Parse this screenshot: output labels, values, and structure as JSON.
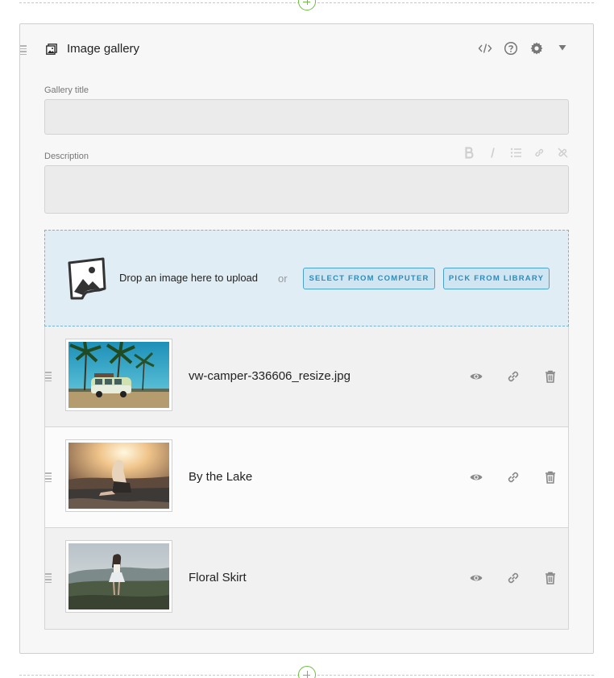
{
  "block": {
    "title": "Image gallery",
    "icons": [
      "gallery-icon",
      "code-icon",
      "help-icon",
      "gear-icon",
      "collapse-icon"
    ]
  },
  "fields": {
    "gallery_title_label": "Gallery title",
    "gallery_title_value": "",
    "description_label": "Description",
    "description_value": "",
    "editor_icons": [
      "bold-icon",
      "italic-icon",
      "list-icon",
      "link-icon",
      "unlink-icon"
    ]
  },
  "dropzone": {
    "text": "Drop an image here to upload",
    "or": "or",
    "select_label": "SELECT FROM COMPUTER",
    "library_label": "PICK FROM LIBRARY"
  },
  "images": [
    {
      "name": "vw-camper-336606_resize.jpg",
      "thumb": "vw-camper-photo"
    },
    {
      "name": "By the Lake",
      "thumb": "lake-photo"
    },
    {
      "name": "Floral Skirt",
      "thumb": "skirt-photo"
    }
  ],
  "row_icons": [
    "eye-icon",
    "link-icon",
    "trash-icon"
  ],
  "colors": {
    "accent": "#4aa3cc",
    "add_green": "#6dbf3c",
    "dropzone_bg": "#e1edf4"
  }
}
